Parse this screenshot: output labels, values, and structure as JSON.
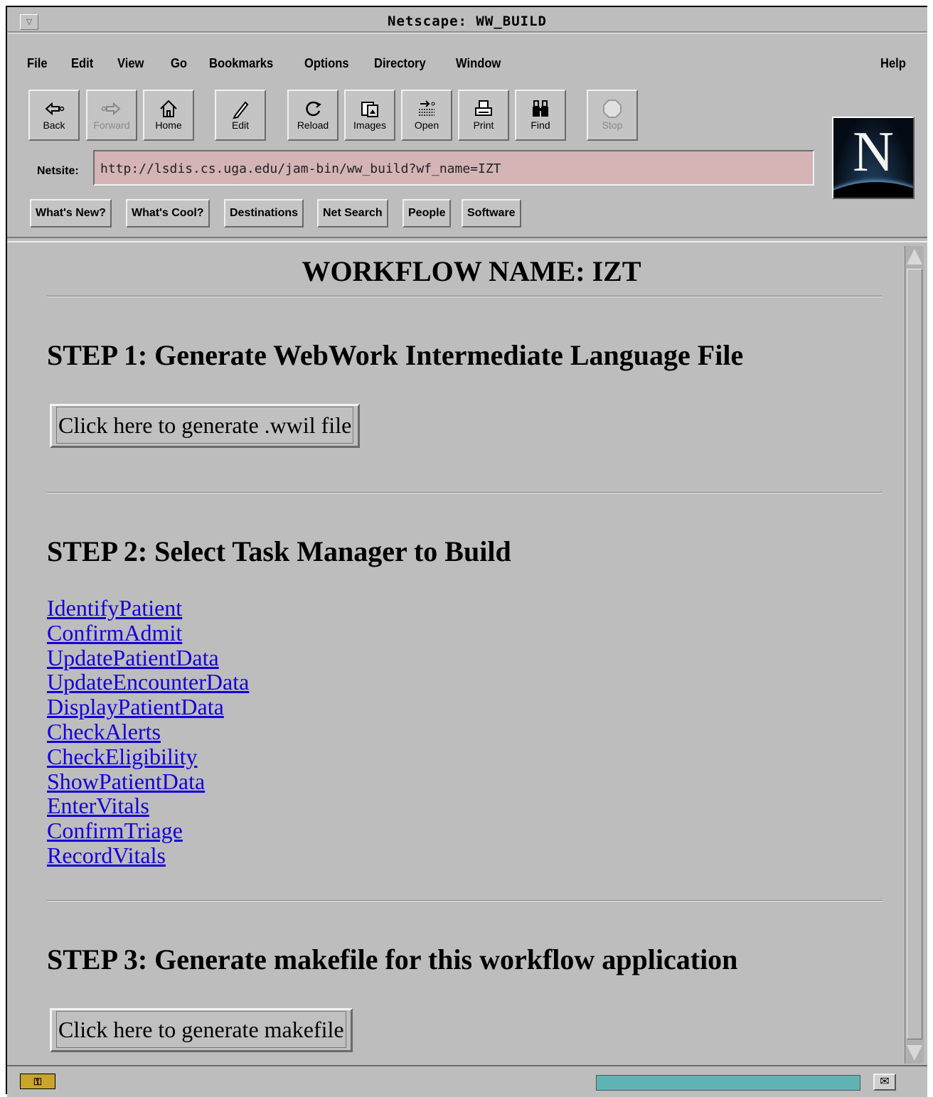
{
  "window": {
    "title": "Netscape: WW_BUILD"
  },
  "menu": [
    "File",
    "Edit",
    "View",
    "Go",
    "Bookmarks",
    "Options",
    "Directory",
    "Window"
  ],
  "menu_help": "Help",
  "toolbar": [
    {
      "label": "Back",
      "icon": "back-arrow-icon",
      "enabled": true
    },
    {
      "label": "Forward",
      "icon": "forward-arrow-icon",
      "enabled": false
    },
    {
      "label": "Home",
      "icon": "home-icon",
      "enabled": true
    },
    {
      "label": "Edit",
      "icon": "pencil-icon",
      "enabled": true
    },
    {
      "label": "Reload",
      "icon": "reload-icon",
      "enabled": true
    },
    {
      "label": "Images",
      "icon": "images-icon",
      "enabled": true
    },
    {
      "label": "Open",
      "icon": "open-icon",
      "enabled": true
    },
    {
      "label": "Print",
      "icon": "printer-icon",
      "enabled": true
    },
    {
      "label": "Find",
      "icon": "binoculars-icon",
      "enabled": true
    },
    {
      "label": "Stop",
      "icon": "stop-icon",
      "enabled": false
    }
  ],
  "location": {
    "label": "Netsite:",
    "url": "http://lsdis.cs.uga.edu/jam-bin/ww_build?wf_name=IZT"
  },
  "directory_buttons": [
    "What's New?",
    "What's Cool?",
    "Destinations",
    "Net Search",
    "People",
    "Software"
  ],
  "logo_letter": "N",
  "page": {
    "title": "WORKFLOW NAME: IZT",
    "step1": {
      "heading": "STEP 1: Generate WebWork Intermediate Language File",
      "button": "Click here to generate .wwil file"
    },
    "step2": {
      "heading": "STEP 2: Select Task Manager to Build",
      "links": [
        "IdentifyPatient",
        "ConfirmAdmit",
        "UpdatePatientData",
        "UpdateEncounterData",
        "DisplayPatientData",
        "CheckAlerts",
        "CheckEligibility",
        "ShowPatientData",
        "EnterVitals",
        "ConfirmTriage",
        "RecordVitals"
      ]
    },
    "step3": {
      "heading": "STEP 3: Generate makefile for this workflow application",
      "button": "Click here to generate makefile"
    }
  },
  "status": {
    "security_icon": "key-icon",
    "mail_icon": "mail-icon",
    "colors": {
      "progress": "#5fb3b3",
      "url_bg": "#d4b4b4",
      "link": "#1400d8",
      "chrome": "#bdbdbd"
    }
  }
}
